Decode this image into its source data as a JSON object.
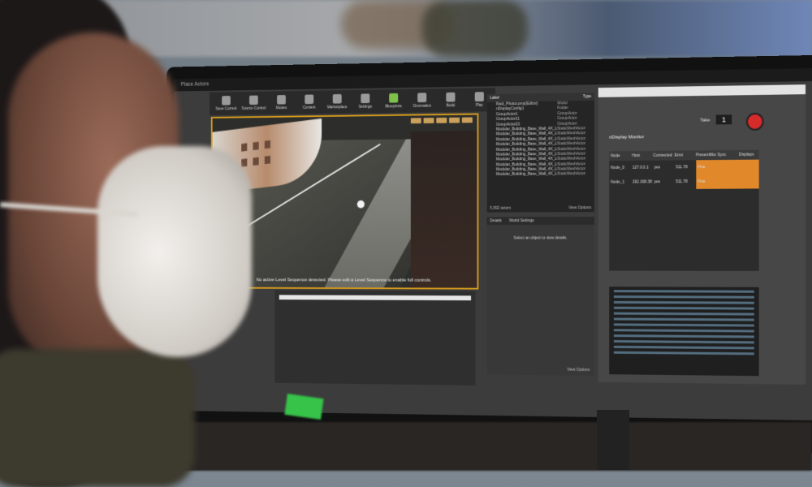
{
  "scene": {
    "description_kind": "photo_of_monitor"
  },
  "menubar": {
    "items": [
      "Place Actors"
    ]
  },
  "toolbar": {
    "items": [
      "Save Current",
      "Source Control",
      "Modes",
      "Content",
      "Marketplace",
      "Settings",
      "Blueprints",
      "Cinematics",
      "Build",
      "Play"
    ]
  },
  "viewport": {
    "message": "No active Level Sequence detected. Please edit a Level Sequence to enable full controls."
  },
  "outliner": {
    "tabs": [
      "Levels",
      "World Outliner"
    ],
    "columns": [
      "Label",
      "Type"
    ],
    "rows": [
      {
        "label": "Raid_Photocomp(Editor)",
        "type": "World"
      },
      {
        "label": "nDisplayConfig1",
        "type": "Folder"
      },
      {
        "label": "GroupActor1",
        "type": "GroupActor"
      },
      {
        "label": "GroupActor11",
        "type": "GroupActor"
      },
      {
        "label": "GroupActor23",
        "type": "GroupActor"
      },
      {
        "label": "Modular_Building_Base_Wall_4X_LOD0",
        "type": "StaticMeshActor"
      },
      {
        "label": "Modular_Building_Base_Wall_4X_LOD0",
        "type": "StaticMeshActor"
      },
      {
        "label": "Modular_Building_Base_Wall_4X_LOD0",
        "type": "StaticMeshActor"
      },
      {
        "label": "Modular_Building_Base_Wall_4X_LOD0",
        "type": "StaticMeshActor"
      },
      {
        "label": "Modular_Building_Base_Wall_4X_LOD0",
        "type": "StaticMeshActor"
      },
      {
        "label": "Modular_Building_Base_Wall_4X_LOD0",
        "type": "StaticMeshActor"
      },
      {
        "label": "Modular_Building_Base_Wall_4X_LOD0",
        "type": "StaticMeshActor"
      },
      {
        "label": "Modular_Building_Base_Wall_4X_LOD0",
        "type": "StaticMeshActor"
      },
      {
        "label": "Modular_Building_Base_Wall_4X_LOD0",
        "type": "StaticMeshActor"
      },
      {
        "label": "Modular_Building_Base_Wall_4X_LOD0",
        "type": "StaticMeshActor"
      }
    ],
    "count": "5,992 actors",
    "view_options": "View Options"
  },
  "details": {
    "tabs": [
      "Details",
      "World Settings"
    ],
    "hint": "Select an object to view details.",
    "view_options": "View Options"
  },
  "right_panel": {
    "take_label": "Take",
    "take_value": "1",
    "title": "nDisplay Monitor",
    "table_headers": [
      "Node",
      "Host",
      "Connected",
      "Error",
      "PresentMode",
      "Sync",
      "Displays"
    ],
    "rows": [
      {
        "node": "Node_0",
        "host": "127.0.0.1",
        "connected": "yes",
        "error": "511.78",
        "status": "Fine"
      },
      {
        "node": "Node_1",
        "host": "192.168.38.12",
        "connected": "yes",
        "error": "511.78",
        "status": "Fine"
      }
    ]
  },
  "colors": {
    "viewport_border": "#d59a1c",
    "record": "#d62b2b",
    "accent_orange": "#e0882a"
  }
}
